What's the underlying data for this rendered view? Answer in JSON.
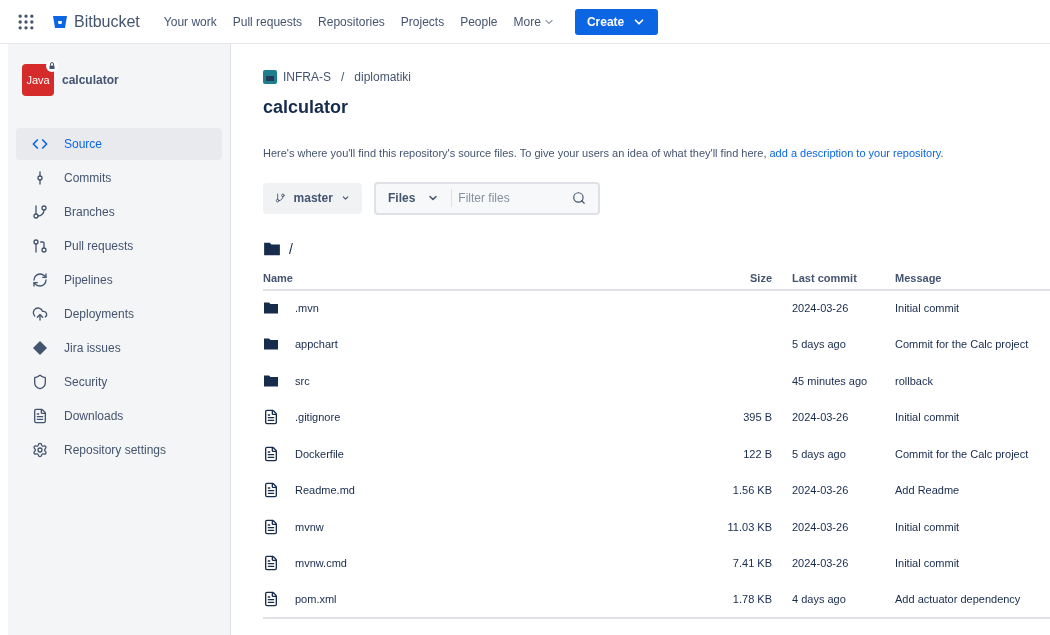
{
  "topnav": {
    "product": "Bitbucket",
    "links": [
      "Your work",
      "Pull requests",
      "Repositories",
      "Projects",
      "People"
    ],
    "more": "More",
    "create": "Create"
  },
  "sidebar": {
    "repo_badge": "Java",
    "repo_name": "calculator",
    "items": [
      {
        "label": "Source",
        "kind": "source",
        "selected": true
      },
      {
        "label": "Commits",
        "kind": "commits",
        "selected": false
      },
      {
        "label": "Branches",
        "kind": "branches",
        "selected": false
      },
      {
        "label": "Pull requests",
        "kind": "pulls",
        "selected": false
      },
      {
        "label": "Pipelines",
        "kind": "pipelines",
        "selected": false
      },
      {
        "label": "Deployments",
        "kind": "deployments",
        "selected": false
      },
      {
        "label": "Jira issues",
        "kind": "jira",
        "selected": false
      },
      {
        "label": "Security",
        "kind": "security",
        "selected": false
      },
      {
        "label": "Downloads",
        "kind": "downloads",
        "selected": false
      },
      {
        "label": "Repository settings",
        "kind": "settings",
        "selected": false
      }
    ]
  },
  "breadcrumbs": [
    "INFRA-S",
    "diplomatiki"
  ],
  "breadcrumb_separator": "/",
  "title": "calculator",
  "description": {
    "text": "Here's where you'll find this repository's source files. To give your users an idea of what they'll find here, ",
    "link": "add a description to your repository",
    "end": "."
  },
  "branch": "master",
  "filter": {
    "type": "Files",
    "placeholder": "Filter files"
  },
  "path": "/",
  "table": {
    "columns": [
      "Name",
      "Size",
      "Last commit",
      "Message"
    ],
    "rows": [
      {
        "kind": "folder",
        "name": ".mvn",
        "size": "",
        "last_commit": "2024-03-26",
        "message": "Initial commit"
      },
      {
        "kind": "folder",
        "name": "appchart",
        "size": "",
        "last_commit": "5 days ago",
        "message": "Commit for the Calc project"
      },
      {
        "kind": "folder",
        "name": "src",
        "size": "",
        "last_commit": "45 minutes ago",
        "message": "rollback"
      },
      {
        "kind": "file",
        "name": ".gitignore",
        "size": "395 B",
        "last_commit": "2024-03-26",
        "message": "Initial commit"
      },
      {
        "kind": "file",
        "name": "Dockerfile",
        "size": "122 B",
        "last_commit": "5 days ago",
        "message": "Commit for the Calc project"
      },
      {
        "kind": "file",
        "name": "Readme.md",
        "size": "1.56 KB",
        "last_commit": "2024-03-26",
        "message": "Add Readme"
      },
      {
        "kind": "file",
        "name": "mvnw",
        "size": "11.03 KB",
        "last_commit": "2024-03-26",
        "message": "Initial commit"
      },
      {
        "kind": "file",
        "name": "mvnw.cmd",
        "size": "7.41 KB",
        "last_commit": "2024-03-26",
        "message": "Initial commit"
      },
      {
        "kind": "file",
        "name": "pom.xml",
        "size": "1.78 KB",
        "last_commit": "4 days ago",
        "message": "Add actuator dependency"
      }
    ]
  }
}
